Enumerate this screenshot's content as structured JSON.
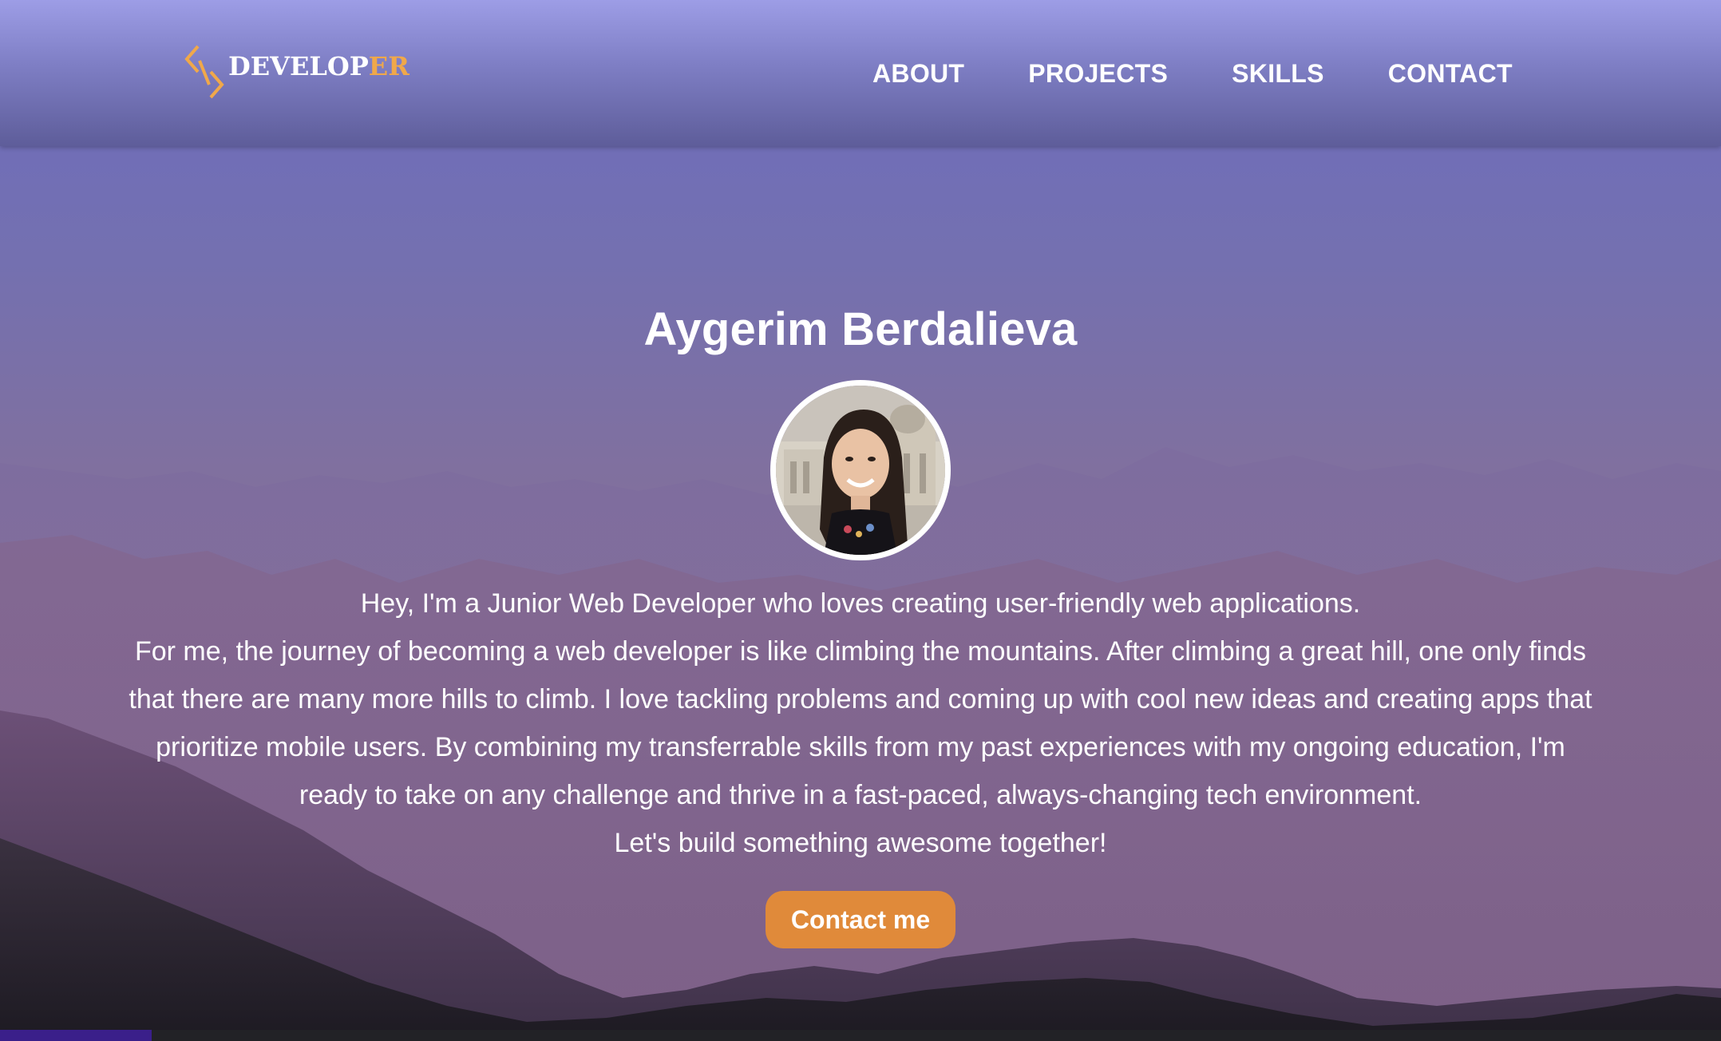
{
  "logo": {
    "text_main": "DEVELOP",
    "text_accent": "ER",
    "accent_color": "#f0a84a"
  },
  "nav": {
    "items": [
      "ABOUT",
      "PROJECTS",
      "SKILLS",
      "CONTACT"
    ]
  },
  "hero": {
    "name": "Aygerim Berdalieva",
    "intro_line1": "Hey, I'm a Junior Web Developer who loves creating user-friendly web applications.",
    "intro_line2": "For me, the journey of becoming a web developer is like climbing the mountains. After climbing a great hill, one only finds that there are many more hills to climb. I love tackling problems and coming up with cool new ideas and creating apps that prioritize mobile users. By combining my transferrable skills from my past experiences with my ongoing education, I'm ready to take on any challenge and thrive in a fast-paced, always-changing tech environment.",
    "intro_line3": "Let's build something awesome together!",
    "cta_label": "Contact me",
    "cta_color": "#e08a3a"
  },
  "icons": {
    "logo": "code-brackets-icon"
  }
}
